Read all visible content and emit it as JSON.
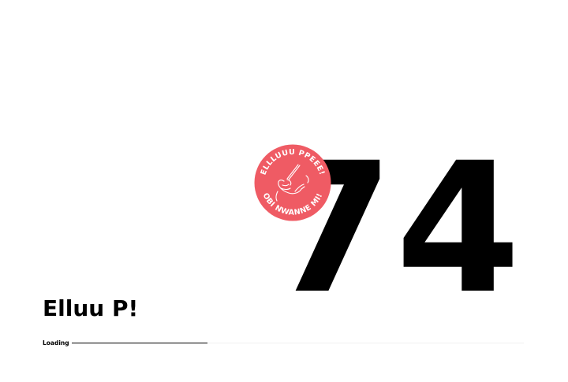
{
  "loader": {
    "counter": "74",
    "progress_percent": 30,
    "label": "Loading"
  },
  "badge": {
    "text_top": "ELLLUUU PPEEE!",
    "text_bottom": "OBI NWANNE MI!",
    "icon": "hand-holding-pen-icon",
    "color": "#ef5b64"
  },
  "brand": {
    "name": "Elluu P!"
  },
  "colors": {
    "text": "#000000",
    "track": "#f0f0f0",
    "background": "#ffffff"
  }
}
